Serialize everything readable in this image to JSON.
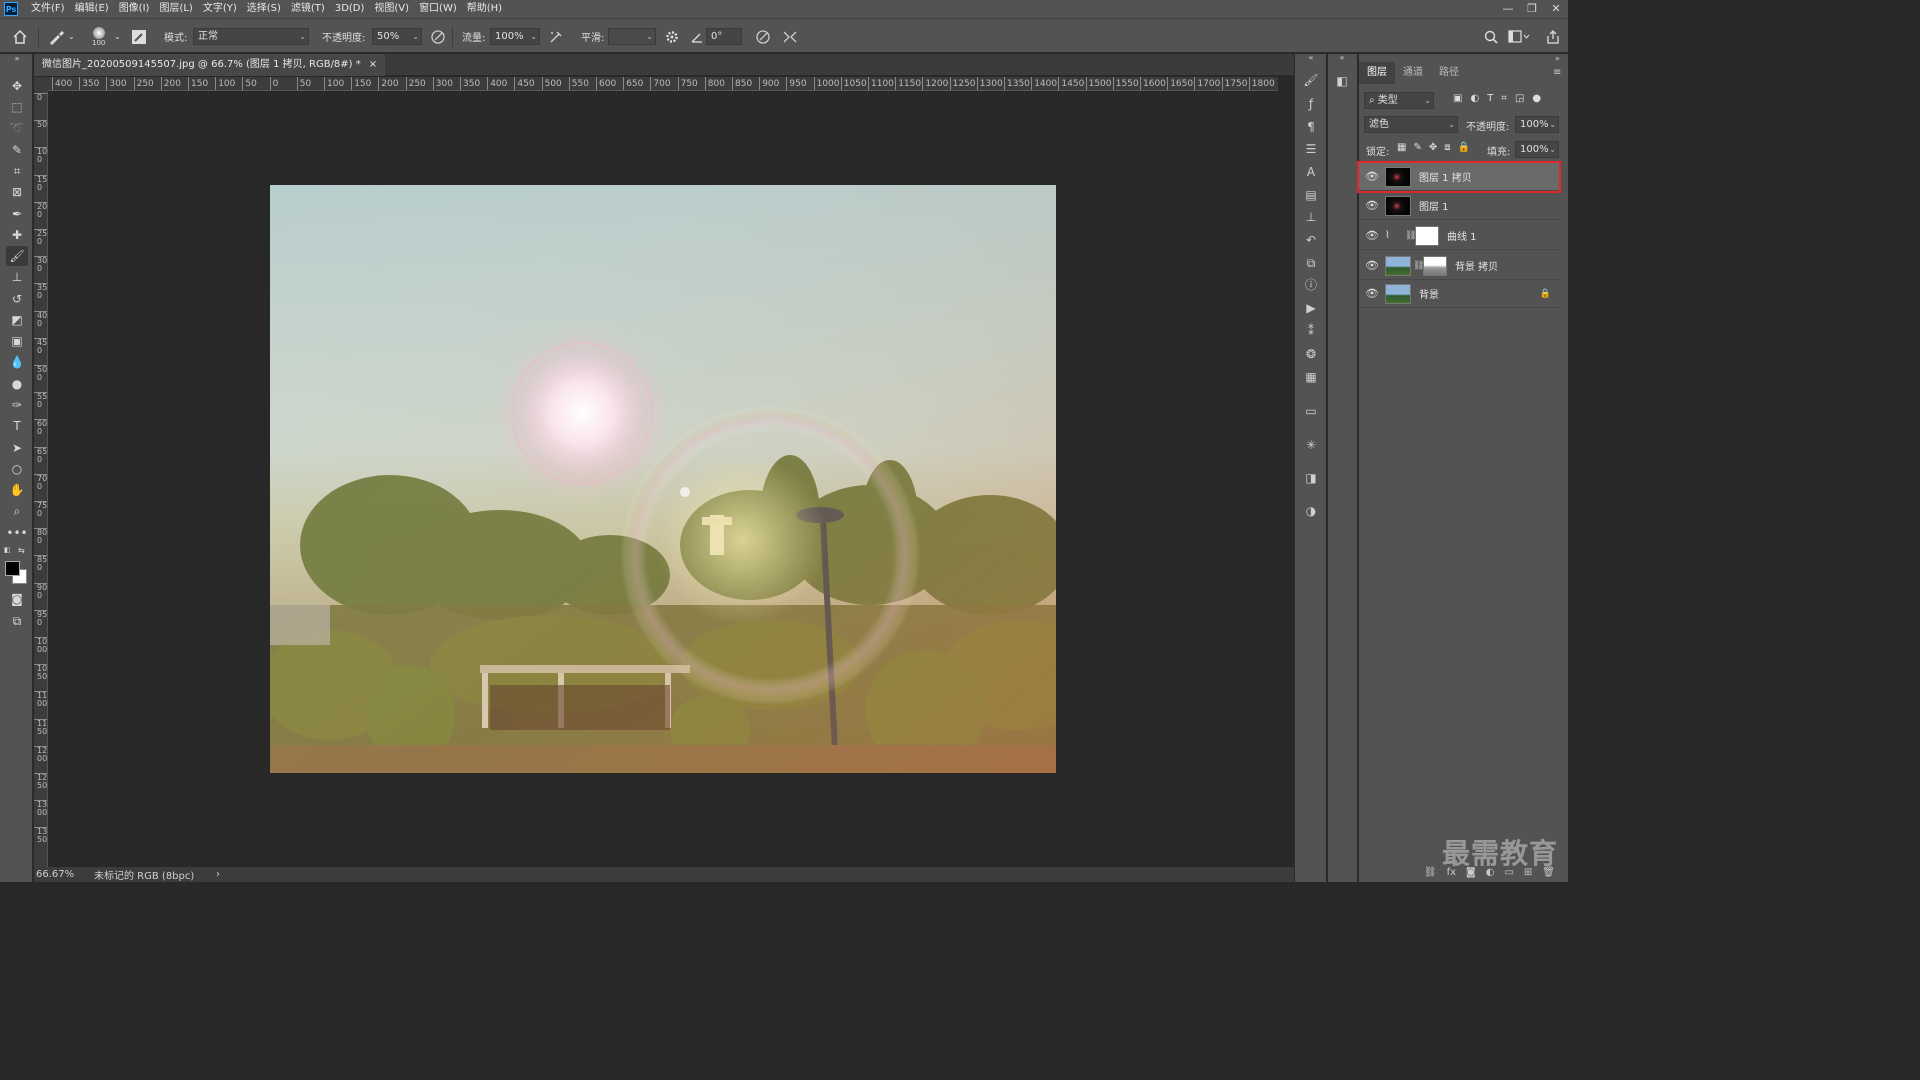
{
  "menubar": {
    "logo": "Ps",
    "items": [
      "文件(F)",
      "编辑(E)",
      "图像(I)",
      "图层(L)",
      "文字(Y)",
      "选择(S)",
      "滤镜(T)",
      "3D(D)",
      "视图(V)",
      "窗口(W)",
      "帮助(H)"
    ],
    "window_controls": [
      "—",
      "❐",
      "✕"
    ]
  },
  "options": {
    "brush_size": "100",
    "mode_label": "模式:",
    "mode_value": "正常",
    "opacity_label": "不透明度:",
    "opacity_value": "50%",
    "flow_label": "流量:",
    "flow_value": "100%",
    "smoothing_label": "平滑:",
    "smoothing_value": "",
    "angle_value": "0°"
  },
  "document": {
    "tab_title": "微信图片_20200509145507.jpg @ 66.7% (图层 1 拷贝, RGB/8#) *",
    "tab_close": "×",
    "zoom": "66.67%",
    "color_profile": "未标记的 RGB (8bpc)",
    "status_arrow": "›"
  },
  "ruler": {
    "h_labels": [
      "400",
      "350",
      "300",
      "250",
      "200",
      "150",
      "100",
      "50",
      "0",
      "50",
      "100",
      "150",
      "200",
      "250",
      "300",
      "350",
      "400",
      "450",
      "500",
      "550",
      "600",
      "650",
      "700",
      "750",
      "800",
      "850",
      "900",
      "950",
      "1000",
      "1050",
      "1100",
      "1150",
      "1200",
      "1250",
      "1300",
      "1350",
      "1400",
      "1450",
      "1500",
      "1550",
      "1600",
      "1650",
      "1700",
      "1750",
      "1800"
    ],
    "v_labels": [
      "0",
      "50",
      "100",
      "150",
      "200",
      "250",
      "300",
      "350",
      "400",
      "450",
      "500",
      "550",
      "600",
      "650",
      "700",
      "750",
      "800",
      "850",
      "900",
      "950",
      "1000",
      "1050",
      "1100",
      "1150",
      "1200",
      "1250",
      "1300",
      "1350"
    ]
  },
  "layers_panel": {
    "tabs": [
      "图层",
      "通道",
      "路径"
    ],
    "filter_label": "类型",
    "blend_mode": "滤色",
    "opacity_label": "不透明度:",
    "opacity_value": "100%",
    "lock_label": "锁定:",
    "fill_label": "填充:",
    "fill_value": "100%",
    "layers": [
      {
        "name": "图层 1 拷贝",
        "selected": true
      },
      {
        "name": "图层 1",
        "selected": false
      },
      {
        "name": "曲线 1",
        "selected": false
      },
      {
        "name": "背景 拷贝",
        "selected": false
      },
      {
        "name": "背景",
        "selected": false
      }
    ],
    "bottom_icons": [
      "⛓",
      "fx",
      "◙",
      "◐",
      "▭",
      "⊞",
      "🗑"
    ]
  },
  "watermark": "最需教育",
  "tools": [
    "move-icon",
    "marquee-icon",
    "lasso-icon",
    "quick-select-icon",
    "crop-icon",
    "frame-icon",
    "eyedropper-icon",
    "healing-icon",
    "brush-icon",
    "stamp-icon",
    "history-brush-icon",
    "eraser-icon",
    "gradient-icon",
    "blur-icon",
    "dodge-icon",
    "pen-icon",
    "type-icon",
    "path-select-icon",
    "ellipse-icon",
    "hand-icon",
    "zoom-icon",
    "more-icon"
  ]
}
